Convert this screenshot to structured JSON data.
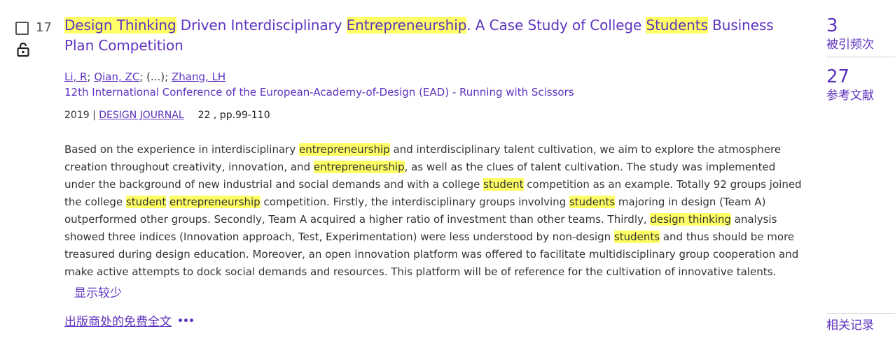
{
  "record": {
    "number": "17",
    "title_parts": [
      {
        "text": "Design Thinking",
        "hl": true
      },
      {
        "text": " Driven Interdisciplinary ",
        "hl": false
      },
      {
        "text": "Entrepreneurship",
        "hl": true
      },
      {
        "text": ". A Case Study of College ",
        "hl": false
      },
      {
        "text": "Students",
        "hl": true
      },
      {
        "text": " Business Plan Competition",
        "hl": false
      }
    ],
    "authors": {
      "a1": "Li, R",
      "a2": "Qian, ZC",
      "sep1": ";",
      "sep2": ";",
      "ellipsis": " (...); ",
      "a3": "Zhang, LH"
    },
    "conference": "12th International Conference of the European-Academy-of-Design (EAD) - Running with Scissors",
    "year_sep": "2019 | ",
    "journal": "DESIGN JOURNAL",
    "volume_pages": "22 , pp.99-110",
    "abstract_parts": [
      {
        "text": "Based on the experience in interdisciplinary ",
        "hl": false
      },
      {
        "text": "entrepreneurship",
        "hl": true
      },
      {
        "text": " and interdisciplinary talent cultivation, we aim to explore the atmosphere creation throughout creativity, innovation, and ",
        "hl": false
      },
      {
        "text": "entrepreneurship",
        "hl": true
      },
      {
        "text": ", as well as the clues of talent cultivation. The study was implemented under the background of new industrial and social demands and with a college ",
        "hl": false
      },
      {
        "text": "student",
        "hl": true
      },
      {
        "text": " competition as an example. Totally 92 groups joined the college ",
        "hl": false
      },
      {
        "text": "student",
        "hl": true
      },
      {
        "text": " ",
        "hl": false
      },
      {
        "text": "entrepreneurship",
        "hl": true
      },
      {
        "text": " competition. Firstly, the interdisciplinary groups involving ",
        "hl": false
      },
      {
        "text": "students",
        "hl": true
      },
      {
        "text": " majoring in design (Team A) outperformed other groups. Secondly, Team A acquired a higher ratio of investment than other teams. Thirdly, ",
        "hl": false
      },
      {
        "text": "design thinking",
        "hl": true
      },
      {
        "text": " analysis showed three indices (Innovation approach, Test, Experimentation) were less understood by non-design ",
        "hl": false
      },
      {
        "text": "students",
        "hl": true
      },
      {
        "text": " and thus should be more treasured during design education. Moreover, an open innovation platform was offered to facilitate multidisciplinary group cooperation and make active attempts to dock social demands and resources. This platform will be of reference for the cultivation of innovative talents.",
        "hl": false
      }
    ],
    "show_less": "显示较少",
    "fulltext_link": "出版商处的免费全文"
  },
  "metrics": {
    "citations_count": "3",
    "citations_label": "被引频次",
    "references_count": "27",
    "references_label": "参考文献",
    "related_label": "相关记录"
  },
  "colors": {
    "accent": "#5e33bf",
    "highlight": "#ffff66"
  },
  "icons": {
    "lock": "open-lock-icon",
    "more": "more-options-icon"
  }
}
